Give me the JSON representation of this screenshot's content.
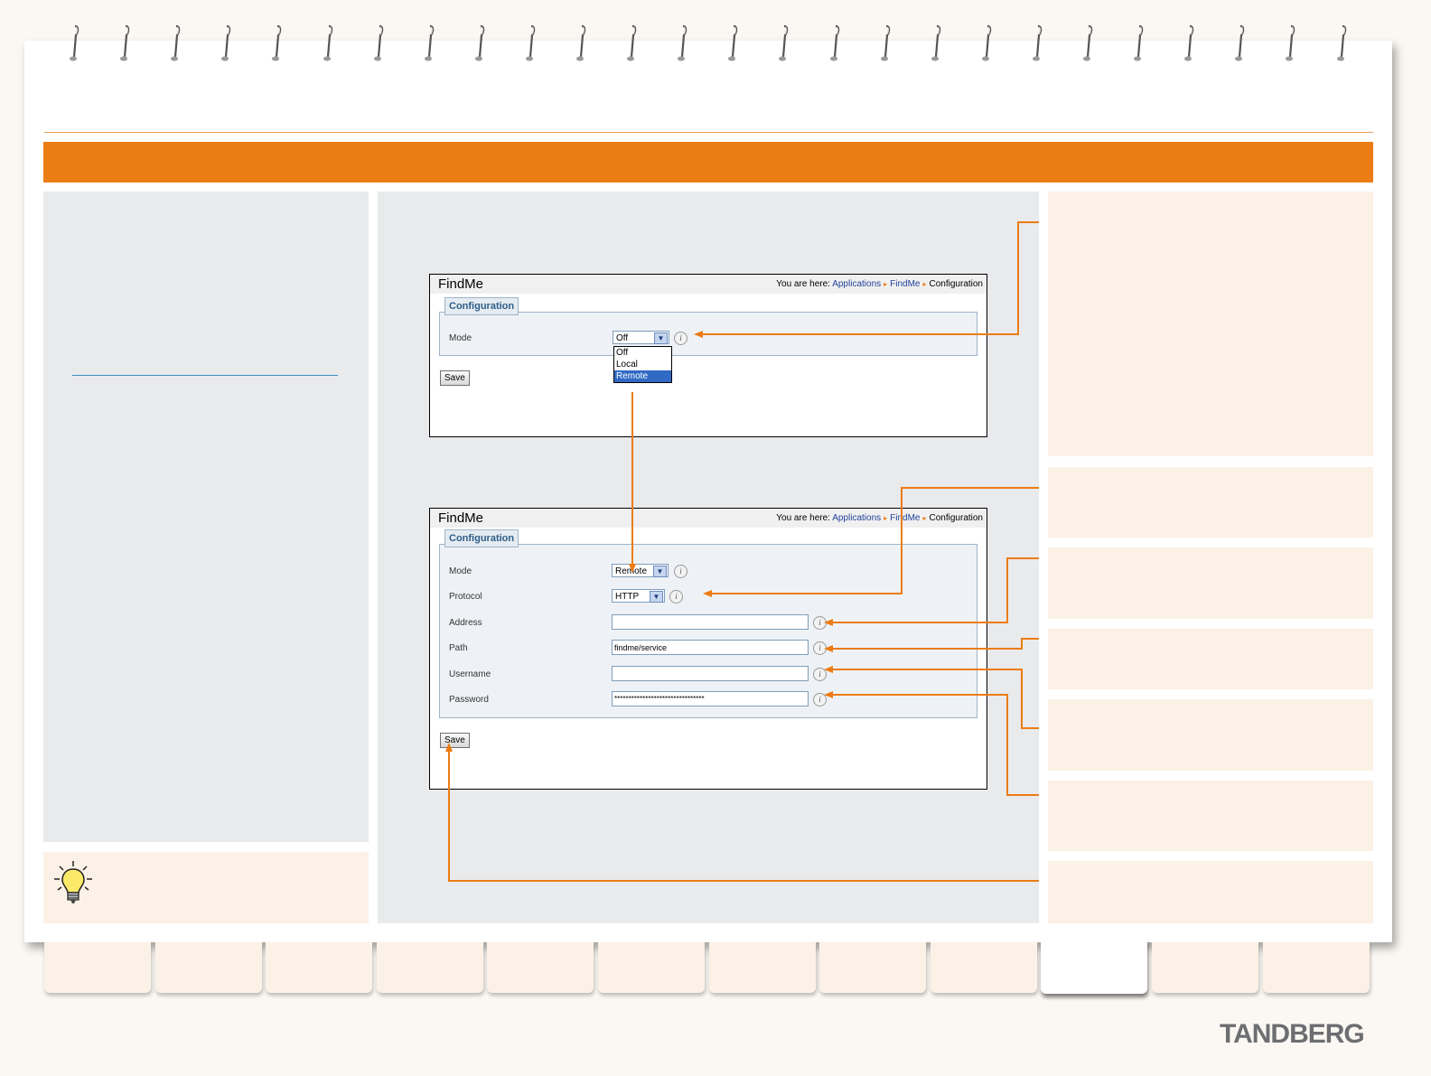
{
  "screenshot_top": {
    "app_title": "FindMe",
    "breadcrumb_prefix": "You are here:",
    "breadcrumb": [
      "Applications",
      "FindMe",
      "Configuration"
    ],
    "legend": "Configuration",
    "mode_label": "Mode",
    "mode_value": "Off",
    "mode_options": [
      "Off",
      "Local",
      "Remote"
    ],
    "mode_highlighted": "Remote",
    "save_label": "Save"
  },
  "screenshot_bottom": {
    "app_title": "FindMe",
    "breadcrumb_prefix": "You are here:",
    "breadcrumb": [
      "Applications",
      "FindMe",
      "Configuration"
    ],
    "legend": "Configuration",
    "fields": {
      "mode": {
        "label": "Mode",
        "value": "Remote"
      },
      "protocol": {
        "label": "Protocol",
        "value": "HTTP"
      },
      "address": {
        "label": "Address",
        "value": ""
      },
      "path": {
        "label": "Path",
        "value": "findme/service"
      },
      "username": {
        "label": "Username",
        "value": ""
      },
      "password": {
        "label": "Password",
        "value": "********************************"
      }
    },
    "save_label": "Save"
  },
  "icons": {
    "info": "i",
    "dropdown_arrow": "▼",
    "crumb_separator": "▸",
    "tip": "lightbulb-icon"
  },
  "brand": {
    "logo_text": "TANDBERG"
  },
  "colors": {
    "accent": "#ec7c14",
    "link": "#23439a",
    "panel": "#e9eaec",
    "callout_bg": "#fcf1e6"
  }
}
